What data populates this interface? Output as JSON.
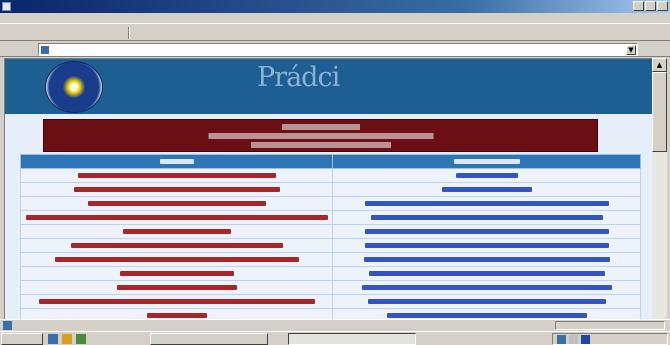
{
  "window": {
    "title": ""
  },
  "menubar": {
    "items": [
      "",
      "",
      "",
      "",
      "",
      "",
      ""
    ]
  },
  "toolbar": {
    "buttons": [
      "",
      "",
      "",
      "",
      "",
      "",
      "",
      "",
      "",
      "",
      ""
    ]
  },
  "addressbar": {
    "label": "",
    "url": "",
    "go_label": ""
  },
  "banner": {
    "site_mark": "Prádci"
  },
  "page_header": {
    "lines": [
      "",
      "",
      ""
    ]
  },
  "table": {
    "headers": [
      "",
      ""
    ],
    "rows": [
      [
        "",
        ""
      ],
      [
        "",
        ""
      ],
      [
        "",
        ""
      ],
      [
        "",
        ""
      ],
      [
        "",
        ""
      ],
      [
        "",
        ""
      ],
      [
        "",
        ""
      ],
      [
        "",
        ""
      ],
      [
        "",
        ""
      ],
      [
        "",
        ""
      ],
      [
        "",
        ""
      ]
    ]
  },
  "statusbar": {
    "zone": ""
  },
  "taskbar": {
    "start_label": "",
    "tasks": [
      "",
      ""
    ],
    "clock": ""
  },
  "colors": {
    "banner": "#1e5f93",
    "header_band": "#6b0f14",
    "table_header": "#2e75b6",
    "link_text": "#3454c4",
    "left_column_text": "#a6262a",
    "page_background": "#e6eef9"
  }
}
